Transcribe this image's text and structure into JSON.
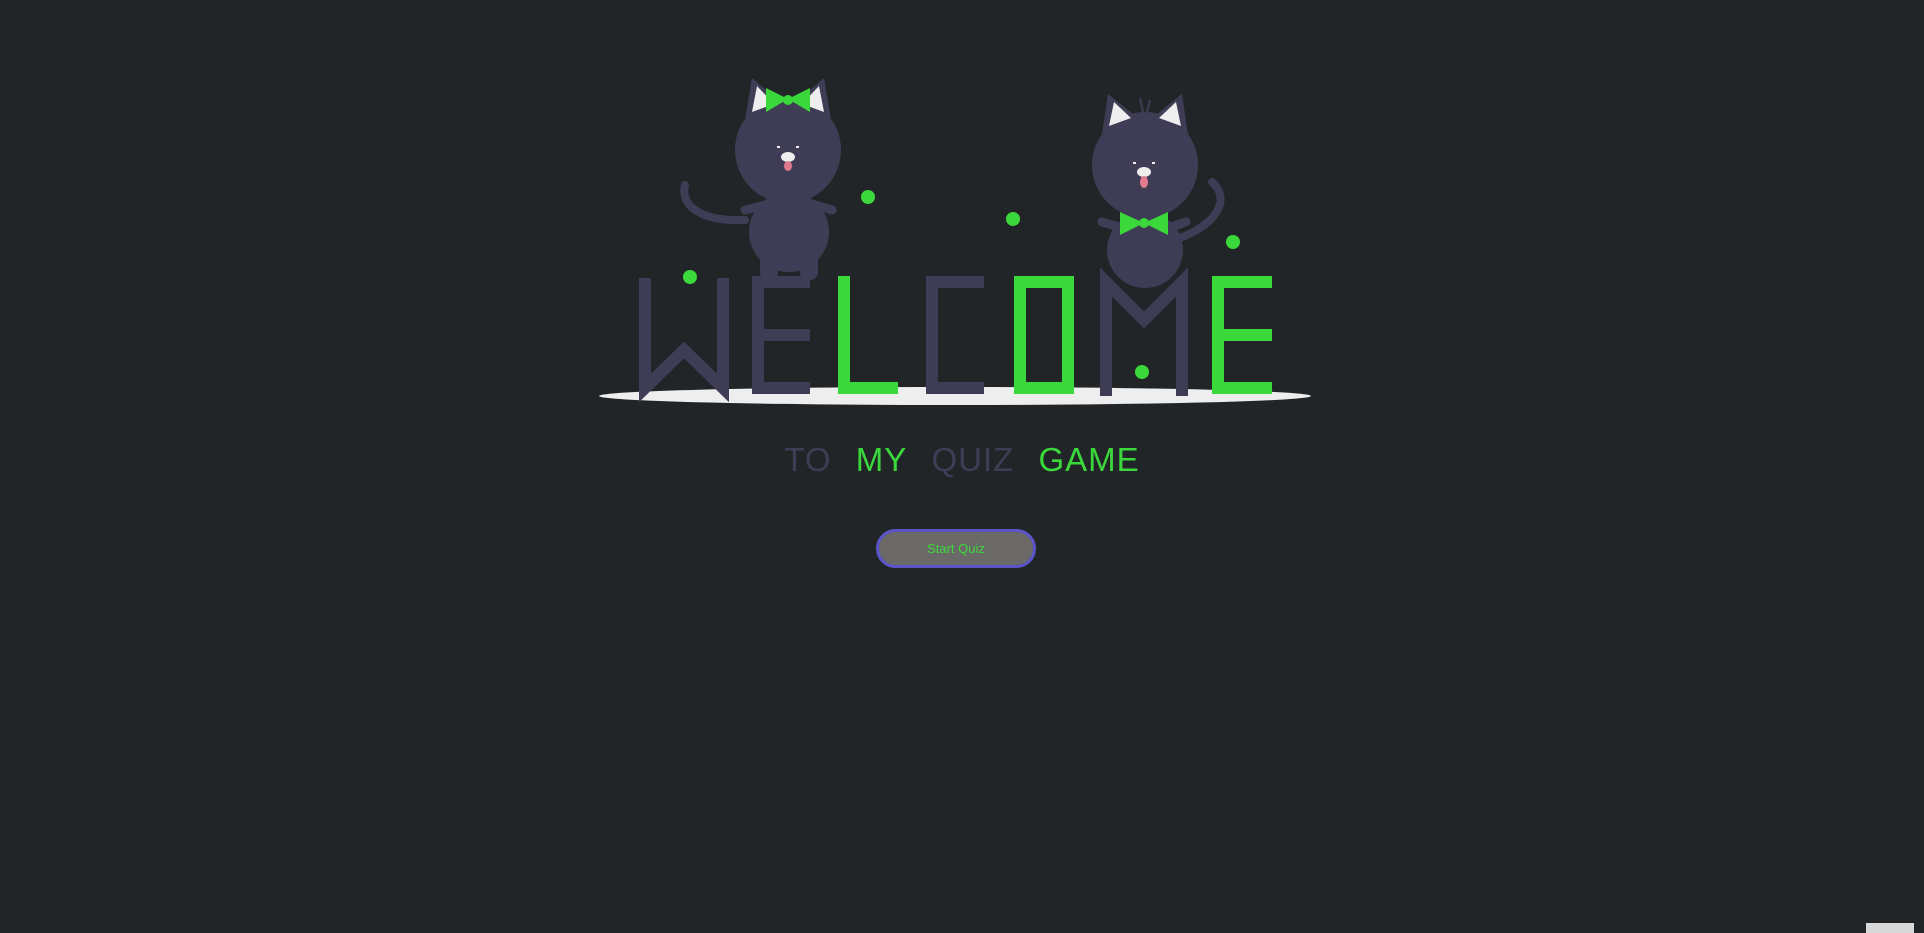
{
  "hero": {
    "word_letters": [
      "W",
      "E",
      "L",
      "C",
      "O",
      "M",
      "E"
    ]
  },
  "subtitle": {
    "parts": [
      {
        "text": "TO",
        "style": "dark"
      },
      {
        "text": "MY",
        "style": "green"
      },
      {
        "text": "QUIZ",
        "style": "dark"
      },
      {
        "text": "GAME",
        "style": "green"
      }
    ]
  },
  "start_button": {
    "label": "Start Quiz"
  },
  "colors": {
    "background": "#222528",
    "dark_letter": "#3f3d56",
    "green": "#3bd83b",
    "button_fill": "#6b6868",
    "button_border": "#5b55c7",
    "floor": "#eeeeee"
  },
  "icons": {
    "left_cat": "cat-with-green-bow-icon",
    "right_cat": "cat-with-green-bowtie-icon",
    "confetti": "green-dot-icon"
  }
}
